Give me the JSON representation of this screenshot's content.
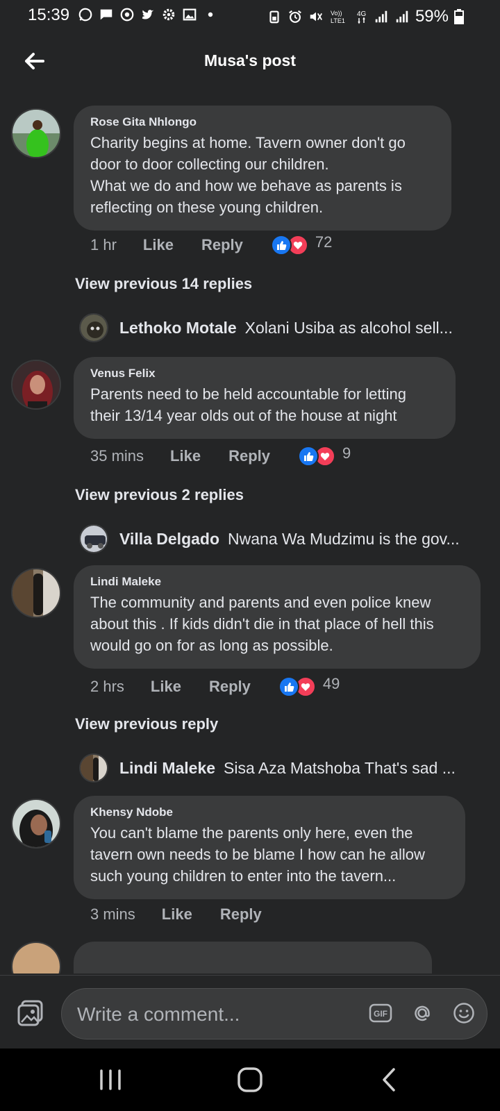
{
  "status_bar": {
    "time": "15:39",
    "battery_percent": "59%",
    "network": "4G",
    "volte_label": "Vo)) LTE1",
    "left_icons": [
      "whatsapp-icon",
      "message-icon",
      "chrome-icon",
      "twitter-icon",
      "settings-icon",
      "gallery-icon",
      "dot-icon"
    ],
    "right_icons": [
      "battery-saver-icon",
      "alarm-icon",
      "mute-icon",
      "volte-icon",
      "signal-icon",
      "signal-icon",
      "battery-icon"
    ]
  },
  "header": {
    "title": "Musa's post",
    "back_icon": "back-arrow-icon"
  },
  "comments": [
    {
      "author": "Rose Gita Nhlongo",
      "text": "Charity begins at home. Tavern owner don't go door to door collecting our children.\nWhat we do and how we behave as parents is reflecting on these young children.",
      "time": "1 hr",
      "like_label": "Like",
      "reply_label": "Reply",
      "reaction_count": "72",
      "view_previous": "View previous 14 replies",
      "reply_preview": {
        "name": "Lethoko Motale",
        "text": "Xolani Usiba as alcohol sell..."
      }
    },
    {
      "author": "Venus Felix",
      "text": "Parents need to be held accountable for letting their 13/14 year olds out of the house at night",
      "time": "35 mins",
      "like_label": "Like",
      "reply_label": "Reply",
      "reaction_count": "9",
      "view_previous": "View previous 2 replies",
      "reply_preview": {
        "name": "Villa Delgado",
        "text": "Nwana Wa Mudzimu is the gov..."
      }
    },
    {
      "author": "Lindi Maleke",
      "text": "The community and parents and even police knew about this . If kids didn't die in that place of hell this would go on for as long as  possible.",
      "time": "2 hrs",
      "like_label": "Like",
      "reply_label": "Reply",
      "reaction_count": "49",
      "view_previous": "View previous reply",
      "reply_preview": {
        "name": "Lindi Maleke",
        "text": "Sisa Aza Matshoba That's sad ..."
      }
    },
    {
      "author": "Khensy Ndobe",
      "text": "You can't blame the parents only here, even the tavern own needs to be blame I how can he allow such young children to enter into the tavern...",
      "time": "3 mins",
      "like_label": "Like",
      "reply_label": "Reply"
    }
  ],
  "composer": {
    "placeholder": "Write a comment...",
    "photo_icon": "photo-icon",
    "gif_icon": "gif-icon",
    "mention_icon": "at-icon",
    "emoji_icon": "emoji-icon"
  },
  "nav_bar": {
    "buttons": [
      "recents-icon",
      "home-icon",
      "back-icon"
    ]
  },
  "colors": {
    "background": "#242526",
    "bubble": "#3a3b3c",
    "text_primary": "#e4e6eb",
    "text_secondary": "#b0b3b8",
    "like_blue": "#1877f2",
    "love_red": "#f33e58"
  }
}
